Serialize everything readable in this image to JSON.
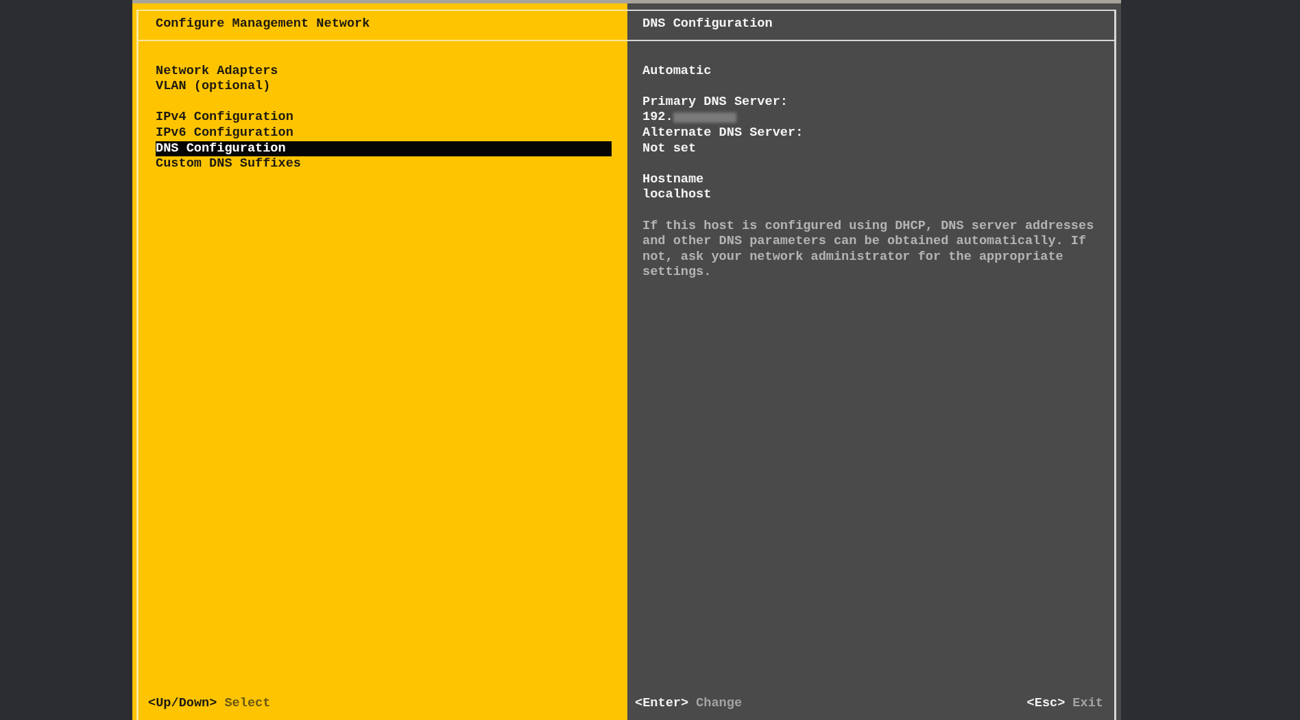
{
  "left_panel": {
    "title": "Configure Management Network",
    "menu_groups": [
      {
        "items": [
          {
            "label": "Network Adapters",
            "selected": false
          },
          {
            "label": "VLAN (optional)",
            "selected": false
          }
        ]
      },
      {
        "items": [
          {
            "label": "IPv4 Configuration",
            "selected": false
          },
          {
            "label": "IPv6 Configuration",
            "selected": false
          },
          {
            "label": "DNS Configuration",
            "selected": true
          },
          {
            "label": "Custom DNS Suffixes",
            "selected": false
          }
        ]
      }
    ],
    "key_hints": [
      {
        "key": "<Up/Down>",
        "action": "Select"
      }
    ]
  },
  "right_panel": {
    "title": "DNS Configuration",
    "mode": "Automatic",
    "dns_servers": [
      {
        "label": "Primary DNS Server:",
        "value": "192.",
        "redacted": true
      },
      {
        "label": "Alternate DNS Server:",
        "value": "Not set",
        "redacted": false
      }
    ],
    "hostname": {
      "label": "Hostname",
      "value": "localhost"
    },
    "help_text": "If this host is configured using DHCP, DNS server addresses and other DNS parameters can be obtained automatically. If not, ask your network administrator for the appropriate settings.",
    "key_hints": [
      {
        "key": "<Enter>",
        "action": "Change"
      },
      {
        "key": "<Esc>",
        "action": "Exit"
      }
    ]
  }
}
